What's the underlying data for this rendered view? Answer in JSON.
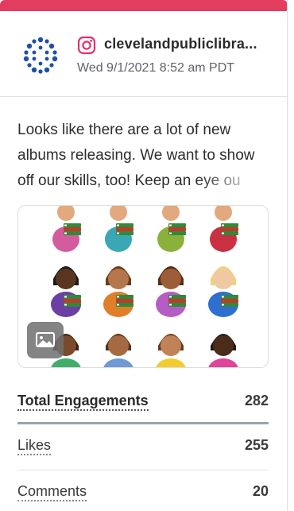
{
  "post": {
    "platform": "instagram",
    "account_name": "clevelandpubliclibra...",
    "timestamp": "Wed 9/1/2021 8:52 am PDT",
    "caption": "Looks like there are a lot of new albums releasing. We want to show off our skills, too! Keep an eye ou"
  },
  "metrics": {
    "total_label": "Total Engagements",
    "total_value": "282",
    "likes_label": "Likes",
    "likes_value": "255",
    "comments_label": "Comments",
    "comments_value": "20"
  },
  "colors": {
    "accent": "#e23d5f",
    "instagram": "#e1306c",
    "logo_blue": "#1f4fa8"
  },
  "icons": {
    "avatar": "cleveland-public-library-logo",
    "platform": "instagram-icon",
    "media_badge": "image-icon"
  }
}
